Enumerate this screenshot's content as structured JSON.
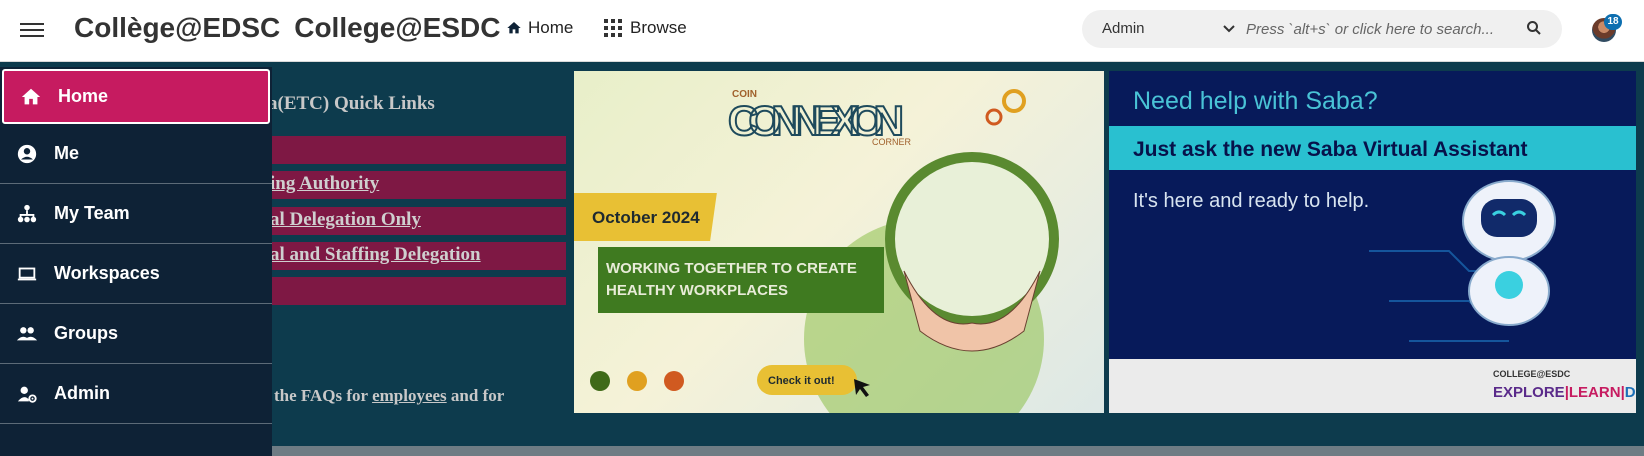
{
  "header": {
    "brand_fr": "Collège@EDSC",
    "brand_en": "College@ESDC",
    "nav": {
      "home": "Home",
      "browse": "Browse"
    },
    "search": {
      "scope": "Admin",
      "placeholder": "Press `alt+s` or click here to search..."
    },
    "notifications_count": "18"
  },
  "sidebar": {
    "items": [
      {
        "label": "Home",
        "icon": "home-icon",
        "active": true
      },
      {
        "label": "Me",
        "icon": "person-circle-icon"
      },
      {
        "label": "My Team",
        "icon": "team-icon"
      },
      {
        "label": "Workspaces",
        "icon": "laptop-icon"
      },
      {
        "label": "Groups",
        "icon": "people-icon"
      },
      {
        "label": "Admin",
        "icon": "admin-gear-icon"
      }
    ]
  },
  "main": {
    "quicklinks_title": "a(ETC) Quick Links",
    "links": [
      "ing Authority",
      "al Delegation Only",
      "al and Staffing Delegation"
    ],
    "faq": {
      "prefix": "the FAQs for ",
      "link": "employees",
      "suffix": " and for"
    }
  },
  "banner_connexion": {
    "brand_top": "COIN",
    "brand_main": "CONNEXION",
    "brand_bottom": "CORNER",
    "date": "October 2024",
    "headline_1": "WORKING TOGETHER TO CREATE",
    "headline_2": "HEALTHY WORKPLACES",
    "cta": "Check it out!"
  },
  "banner_saba": {
    "title": "Need help with Saba?",
    "subtitle_pre": "Just ask the ",
    "subtitle_bold": "new",
    "subtitle_post": " Saba Virtual Assistant",
    "tagline": "It's here and ready to help.",
    "logo_top": "COLLEGE@ESDC",
    "logo_explore": "EXPLORE",
    "logo_learn": "LEARN",
    "logo_do": "DO"
  },
  "colors": {
    "primary_active": "#c61b60",
    "sidebar_bg": "#0e2236",
    "content_bg": "#0d3b4d",
    "quicklink_bar": "#7e1844"
  }
}
